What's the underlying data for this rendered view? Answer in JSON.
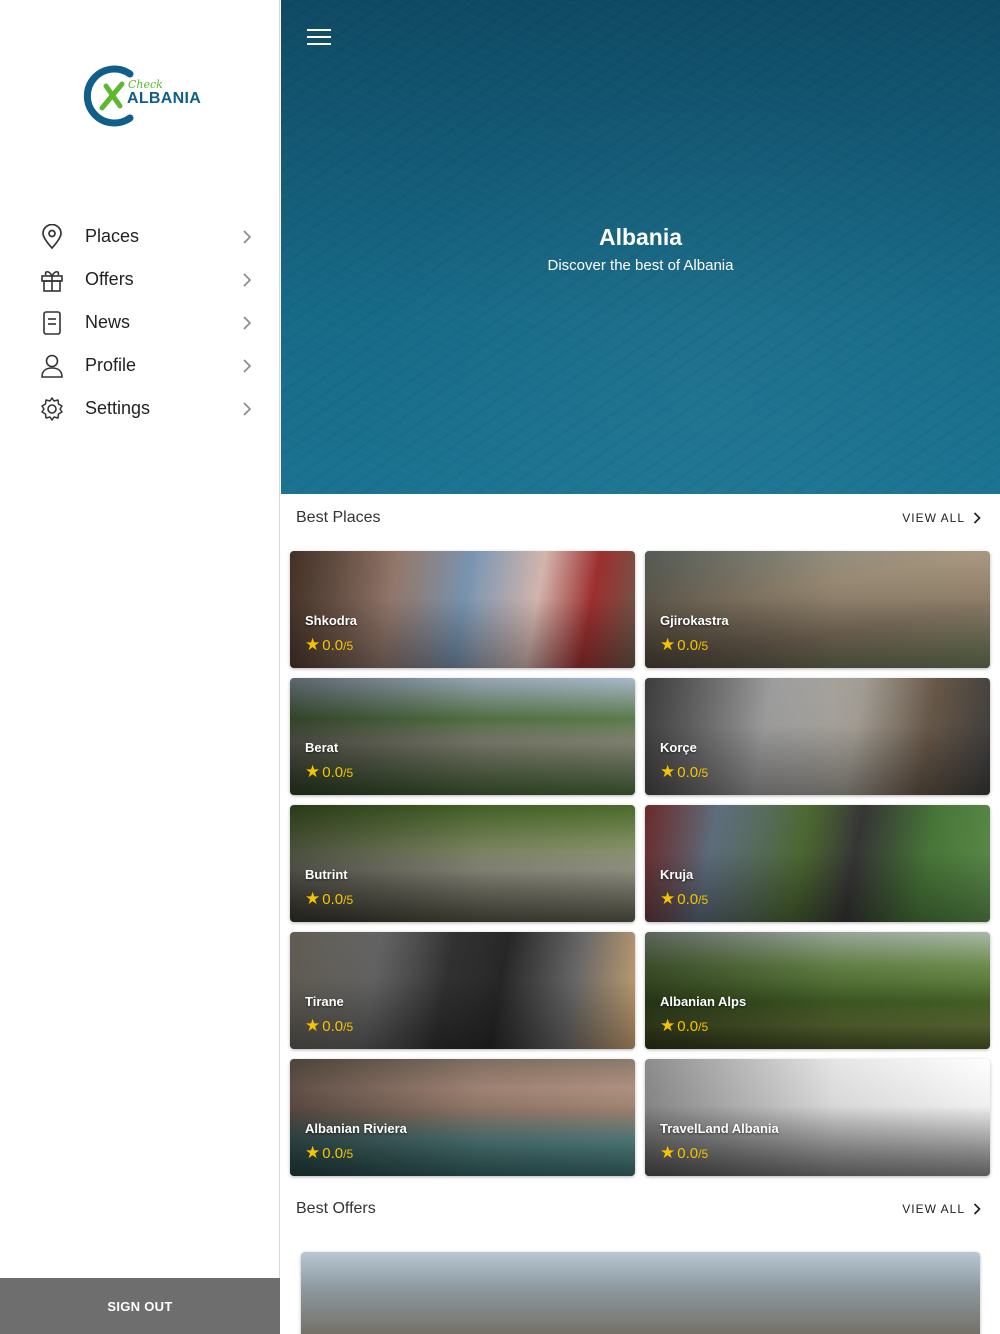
{
  "sidebar": {
    "logo": {
      "script": "Check",
      "text": "ALBANIA"
    },
    "items": [
      {
        "label": "Places",
        "icon": "map-pin-icon"
      },
      {
        "label": "Offers",
        "icon": "gift-icon"
      },
      {
        "label": "News",
        "icon": "document-icon"
      },
      {
        "label": "Profile",
        "icon": "user-icon"
      },
      {
        "label": "Settings",
        "icon": "gear-icon"
      }
    ],
    "signout_label": "SIGN OUT"
  },
  "hero": {
    "title": "Albania",
    "subtitle": "Discover the best of Albania"
  },
  "best_places": {
    "title": "Best Places",
    "view_all": "VIEW ALL",
    "cards": [
      {
        "name": "Shkodra",
        "rating": "0.0",
        "max": "/5"
      },
      {
        "name": "Gjirokastra",
        "rating": "0.0",
        "max": "/5"
      },
      {
        "name": "Berat",
        "rating": "0.0",
        "max": "/5"
      },
      {
        "name": "Korçe",
        "rating": "0.0",
        "max": "/5"
      },
      {
        "name": "Butrint",
        "rating": "0.0",
        "max": "/5"
      },
      {
        "name": "Kruja",
        "rating": "0.0",
        "max": "/5"
      },
      {
        "name": "Tirane",
        "rating": "0.0",
        "max": "/5"
      },
      {
        "name": "Albanian Alps",
        "rating": "0.0",
        "max": "/5"
      },
      {
        "name": "Albanian Riviera",
        "rating": "0.0",
        "max": "/5"
      },
      {
        "name": "TravelLand Albania",
        "rating": "0.0",
        "max": "/5"
      }
    ]
  },
  "best_offers": {
    "title": "Best Offers",
    "view_all": "VIEW ALL"
  },
  "colors": {
    "hero": "#176b88",
    "rating_star": "#f5c400",
    "signout_bg": "#6e6e6e",
    "logo_blue": "#0f5f8a",
    "logo_green": "#5cb82e"
  }
}
